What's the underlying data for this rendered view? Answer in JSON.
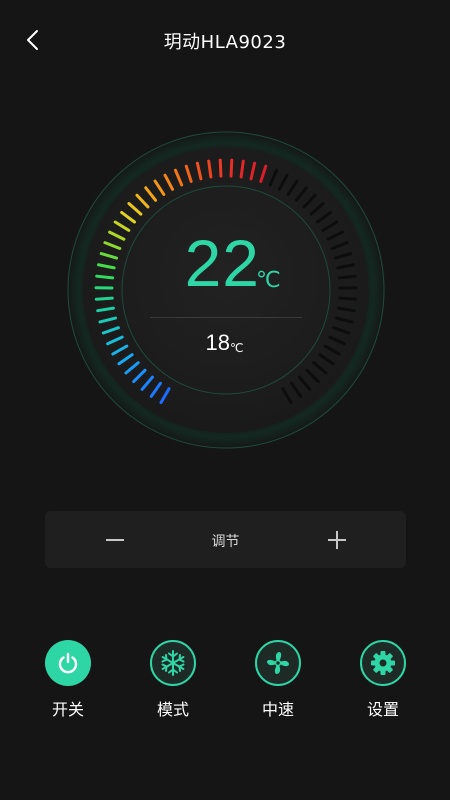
{
  "header": {
    "title": "玥动HLA9023",
    "back_icon": "chevron-left-icon"
  },
  "thermostat": {
    "set_temperature": "22",
    "set_unit": "℃",
    "current_temperature": "18",
    "current_unit": "℃",
    "accent_color": "#2ed6a6"
  },
  "adjust": {
    "label": "调节",
    "minus_icon": "minus-icon",
    "plus_icon": "plus-icon"
  },
  "controls": [
    {
      "label": "开关",
      "icon": "power-icon",
      "active": true
    },
    {
      "label": "模式",
      "icon": "snowflake-icon",
      "active": false
    },
    {
      "label": "中速",
      "icon": "fan-icon",
      "active": false
    },
    {
      "label": "设置",
      "icon": "gear-icon",
      "active": false
    }
  ]
}
